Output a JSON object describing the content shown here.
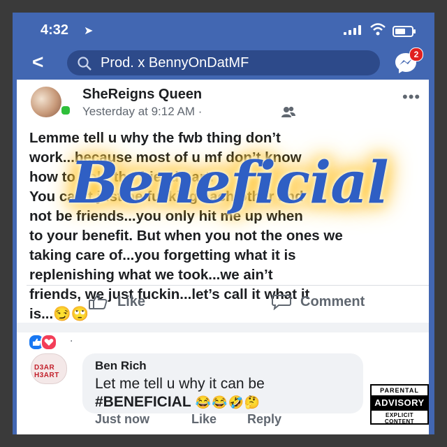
{
  "status_bar": {
    "time": "4:32",
    "location_glyph": "➤"
  },
  "header": {
    "back_glyph": "<",
    "search_query": "Prod. x BennyOnDatMF",
    "messenger_badge": "2"
  },
  "post": {
    "author": "SheReigns Queen",
    "timestamp": "Yesterday at 9:12 AM",
    "separator": " · ",
    "more_glyph": "•••",
    "text_lines": [
      "Lemme tell u why the fwb thing don’t",
      "work...because most of u mf don’t know",
      "how to hold the friend part.",
      "You can’t just be fucking each other and",
      "not be friends...you only hit me up when",
      "to your benefit. But when you not the ones we",
      "taking care of...you forgetting what it is",
      "replenishing what we took...we ain’t",
      "friends, we just fuckin...let’s call it what it",
      "is...😏🙄"
    ],
    "actions": {
      "like": "Like",
      "comment": "Comment"
    },
    "reactions": {
      "extra": "."
    }
  },
  "comment": {
    "avatar_text": "D3AR H3ART",
    "author": "Ben Rich",
    "line1": "Let me tell u why it can be",
    "line2_tag": "#BENEFICIAL",
    "line2_emoji": " 😂😂🤣🤔",
    "time": "Just now",
    "like": "Like",
    "reply": "Reply"
  },
  "overlay_title": "Beneficial",
  "advisory": {
    "top": "PARENTAL",
    "middle": "ADVISORY",
    "bottom": "EXPLICIT CONTENT"
  },
  "colors": {
    "facebook_blue": "#4267b2",
    "overlay_blue": "#2f5fc4",
    "glow": "#ffb400"
  },
  "icons": [
    "location-arrow-icon",
    "cellular-signal-icon",
    "wifi-icon",
    "battery-icon",
    "back-arrow-icon",
    "search-icon",
    "messenger-icon",
    "audience-friends-icon",
    "more-options-icon",
    "thumbs-up-icon",
    "comment-icon"
  ]
}
